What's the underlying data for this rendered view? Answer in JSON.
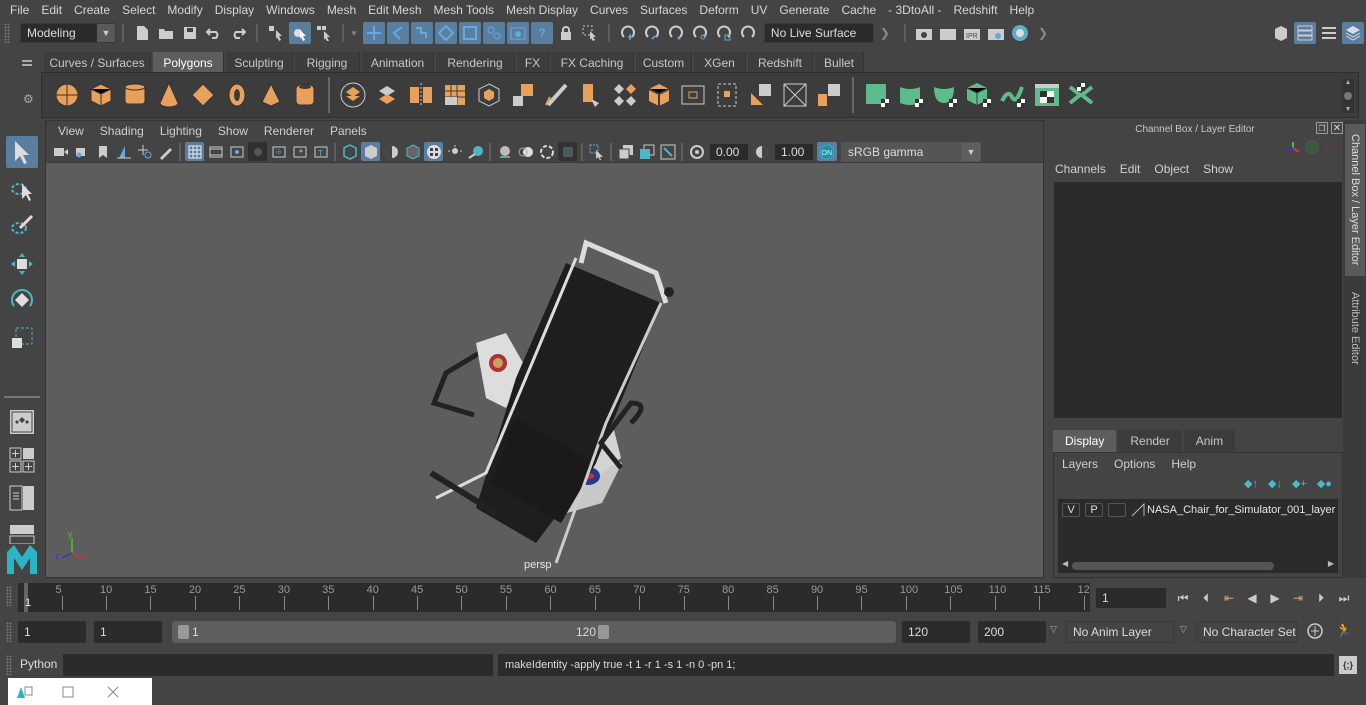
{
  "menubar": {
    "items": [
      "File",
      "Edit",
      "Create",
      "Select",
      "Modify",
      "Display",
      "Windows",
      "Mesh",
      "Edit Mesh",
      "Mesh Tools",
      "Mesh Display",
      "Curves",
      "Surfaces",
      "Deform",
      "UV",
      "Generate",
      "Cache",
      "- 3DtoAll -",
      "Redshift",
      "Help"
    ]
  },
  "statusline": {
    "workspace": "Modeling",
    "live_surface": "No Live Surface"
  },
  "shelf": {
    "tabs": [
      "Curves / Surfaces",
      "Polygons",
      "Sculpting",
      "Rigging",
      "Animation",
      "Rendering",
      "FX",
      "FX Caching",
      "Custom",
      "XGen",
      "Redshift",
      "Bullet"
    ],
    "active_tab": "Polygons"
  },
  "viewport": {
    "menu": [
      "View",
      "Shading",
      "Lighting",
      "Show",
      "Renderer",
      "Panels"
    ],
    "exposure": "0.00",
    "gamma": "1.00",
    "color_mgmt_toggle": "ON",
    "color_space": "sRGB gamma",
    "camera_label": "persp",
    "axis": {
      "x": "x",
      "y": "y",
      "z": "z"
    }
  },
  "channelbox": {
    "title": "Channel Box / Layer Editor",
    "menu": [
      "Channels",
      "Edit",
      "Object",
      "Show"
    ],
    "layer_tabs": [
      "Display",
      "Render",
      "Anim"
    ],
    "active_layer_tab": "Display",
    "layer_menu": [
      "Layers",
      "Options",
      "Help"
    ],
    "layers": [
      {
        "visible": "V",
        "playback": "P",
        "name": "NASA_Chair_for_Simulator_001_layer"
      }
    ]
  },
  "sidetabs": [
    "Channel Box / Layer Editor",
    "Attribute Editor"
  ],
  "timeline": {
    "ticks": [
      "5",
      "10",
      "15",
      "20",
      "25",
      "30",
      "35",
      "40",
      "45",
      "50",
      "55",
      "60",
      "65",
      "70",
      "75",
      "80",
      "85",
      "90",
      "95",
      "100",
      "105",
      "110",
      "115",
      "12"
    ],
    "current_marker": "1",
    "current_frame": "1"
  },
  "range": {
    "start_time": "1",
    "playback_start": "1",
    "slider_start": "1",
    "slider_end": "120",
    "playback_end": "120",
    "end_time": "200",
    "anim_layer": "No Anim Layer",
    "character_set": "No Character Set"
  },
  "cmdline": {
    "language": "Python",
    "input_value": "",
    "result": "makeIdentity -apply true -t 1 -r 1 -s 1 -n 0 -pn 1;"
  },
  "colors": {
    "accent_blue": "#5a7ea0",
    "shelf_orange": "#e8a05a",
    "shelf_green": "#5dbb8c",
    "viewport_bg": "#5d5d5d"
  }
}
